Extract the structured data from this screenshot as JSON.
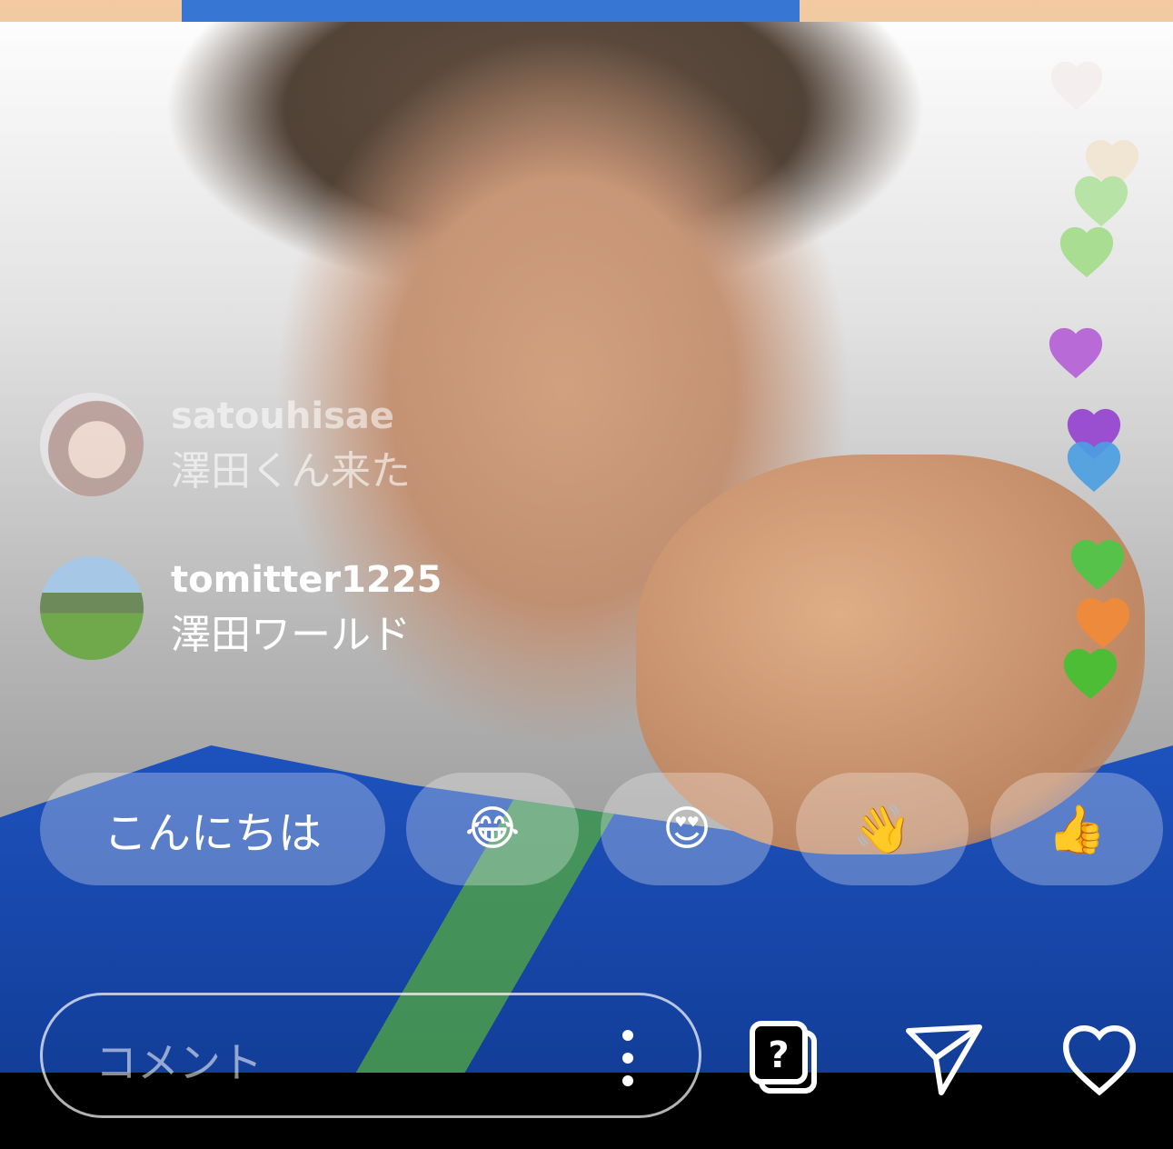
{
  "comments": [
    {
      "username": "satouhisae",
      "message": "澤田くん来た"
    },
    {
      "username": "tomitter1225",
      "message": "澤田ワールド"
    }
  ],
  "quick_replies": {
    "text": "こんにちは",
    "emojis": [
      "😂",
      "😍",
      "👋",
      "👍"
    ]
  },
  "comment_box": {
    "placeholder": "コメント"
  },
  "icons": {
    "more": "more-vertical-icon",
    "qa": "question-box-icon",
    "send": "paper-plane-icon",
    "like": "heart-outline-icon"
  },
  "hearts": [
    {
      "color": "#f3e9ea"
    },
    {
      "color": "#f1e6d3"
    },
    {
      "color": "#b7e3a6"
    },
    {
      "color": "#a9dd91"
    },
    {
      "color": "#b86bd6"
    },
    {
      "color": "#9a4fd0"
    },
    {
      "color": "#4a9fe3"
    },
    {
      "color": "#56c24a"
    },
    {
      "color": "#ee8a3b"
    },
    {
      "color": "#4cbd35"
    }
  ]
}
